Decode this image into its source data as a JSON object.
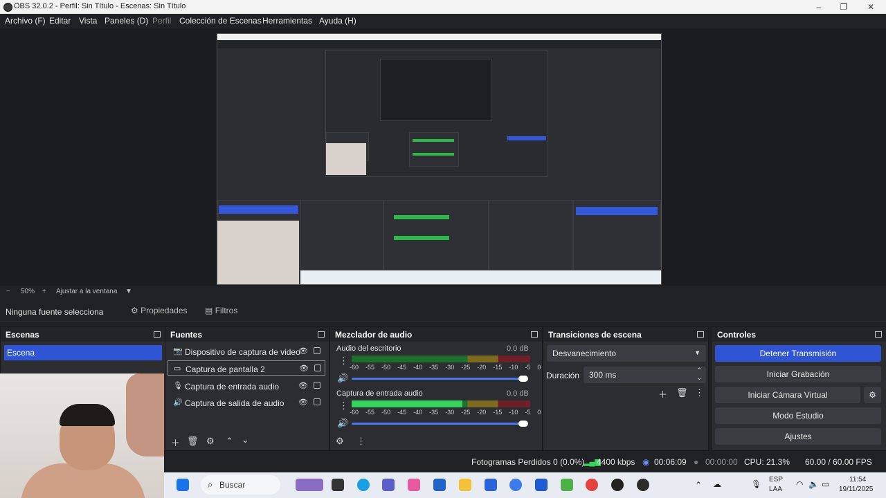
{
  "window": {
    "title": "OBS 32.0.2 - Perfil: Sin Título - Escenas: Sin Título"
  },
  "menu": [
    "Archivo (F)",
    "Editar",
    "Vista",
    "Paneles (D)",
    "Perfil",
    "Colección de Escenas",
    "Herramientas",
    "Ayuda (H)"
  ],
  "zoom": {
    "minus": "−",
    "value": "50%",
    "plus": "+",
    "fit": "Ajustar a la ventana"
  },
  "source_bar": {
    "label": "Ninguna fuente selecciona",
    "properties": "Propiedades",
    "filters": "Filtros"
  },
  "docks": {
    "scenes": {
      "title": "Escenas",
      "items": [
        "Escena"
      ]
    },
    "sources": {
      "title": "Fuentes",
      "items": [
        "Dispositivo de captura de video",
        "Captura de pantalla 2",
        "Captura de entrada audio",
        "Captura de salida de audio"
      ]
    },
    "mixer": {
      "title": "Mezclador de audio",
      "channels": [
        {
          "name": "Audio del escritorio",
          "db": "0.0 dB",
          "level": 0.0
        },
        {
          "name": "Captura de entrada audio",
          "db": "0.0 dB",
          "level": 0.62
        }
      ],
      "ticks": [
        "-60",
        "-55",
        "-50",
        "-45",
        "-40",
        "-35",
        "-30",
        "-25",
        "-20",
        "-15",
        "-10",
        "-5",
        "0"
      ]
    },
    "transitions": {
      "title": "Transiciones de escena",
      "selected": "Desvanecimiento",
      "duration_label": "Duración",
      "duration_value": "300 ms"
    },
    "controls": {
      "title": "Controles",
      "buttons": [
        "Detener Transmisión",
        "Iniciar Grabación",
        "Iniciar Cámara Virtual",
        "Modo Estudio",
        "Ajustes"
      ]
    }
  },
  "status": {
    "dropped": "Fotogramas Perdidos 0 (0.0%)",
    "bitrate": "4400 kbps",
    "stream_time": "00:06:09",
    "rec_time": "00:00:00",
    "cpu": "CPU: 21.3%",
    "fps": "60.00 / 60.00 FPS"
  },
  "taskbar": {
    "search": "Buscar",
    "lang1": "ESP",
    "lang2": "LAA",
    "time": "11:54",
    "date": "19/11/2025"
  },
  "colors": {
    "accent": "#2f55d4",
    "bg": "#202124",
    "dock": "#2b2d31"
  }
}
